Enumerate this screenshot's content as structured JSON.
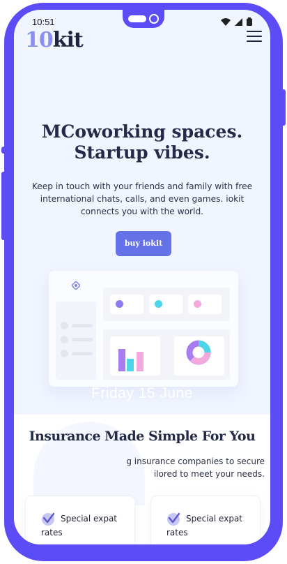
{
  "status": {
    "time": "10:51"
  },
  "logo": {
    "part1": "10",
    "part2": "kit"
  },
  "hero": {
    "title_line1": "MCoworking spaces.",
    "title_line2": "Startup vibes.",
    "text": "Keep in touch with your friends and family with free international chats, calls, and even games. iokit connects you with the world.",
    "button_label": "buy iokit"
  },
  "mockup": {
    "date": "Friday 15 June"
  },
  "section": {
    "title": "Insurance Made Simple For You",
    "text": "g insurance companies to secure\nilored to meet your needs."
  },
  "features": [
    {
      "label": "Special expat rates"
    },
    {
      "label": "Special expat rates"
    }
  ],
  "colors": {
    "frame": "#5b4cf5",
    "background": "#f1f5ff",
    "button": "#6571e6",
    "heading": "#252a48",
    "logo_accent": "#8a8ff0"
  }
}
